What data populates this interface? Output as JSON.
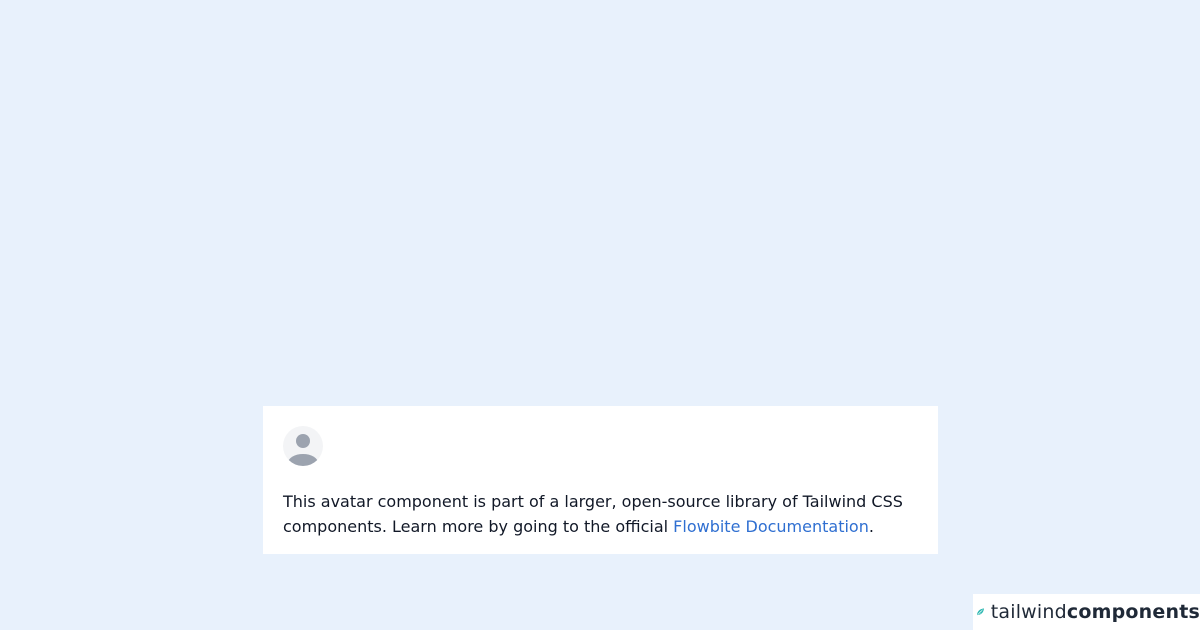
{
  "card": {
    "avatar_alt": "avatar placeholder",
    "text_before": "This avatar component is part of a larger, open-source library of Tailwind CSS components. Learn more by going to the official ",
    "link_text": "Flowbite Documentation",
    "text_after": "."
  },
  "brand": {
    "light": "tailwind",
    "bold": "components",
    "icon": "tailwind-leaf-icon",
    "icon_color": "#2ab6b0"
  },
  "colors": {
    "background": "#e8f1fc",
    "card": "#ffffff",
    "link": "#2f6fd1",
    "avatar_bg": "#f3f4f6",
    "avatar_fg": "#9ca3af"
  }
}
